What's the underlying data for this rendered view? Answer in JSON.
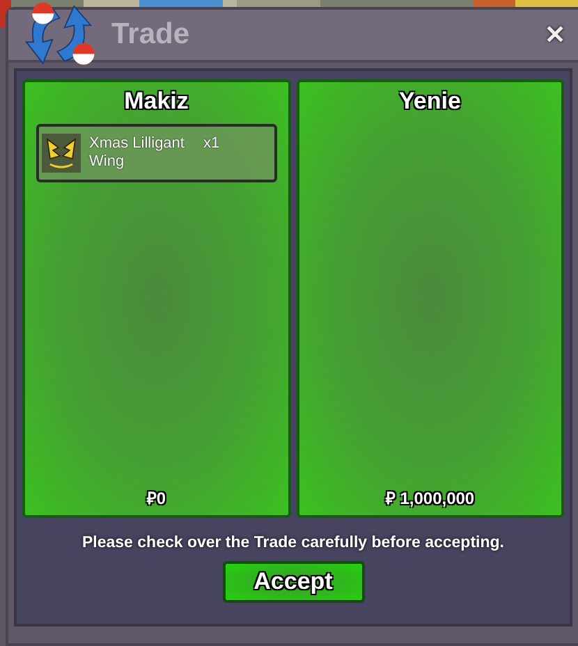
{
  "window": {
    "title": "Trade",
    "close": "✕"
  },
  "panels": [
    {
      "player": "Makiz",
      "items": [
        {
          "name": "Xmas Lilligant Wing",
          "quantity": "x1"
        }
      ],
      "money": "₽0"
    },
    {
      "player": "Yenie",
      "money": "₽ 1,000,000"
    }
  ],
  "notice": "Please check over the Trade carefully before accepting.",
  "buttons": [
    "Accept"
  ]
}
